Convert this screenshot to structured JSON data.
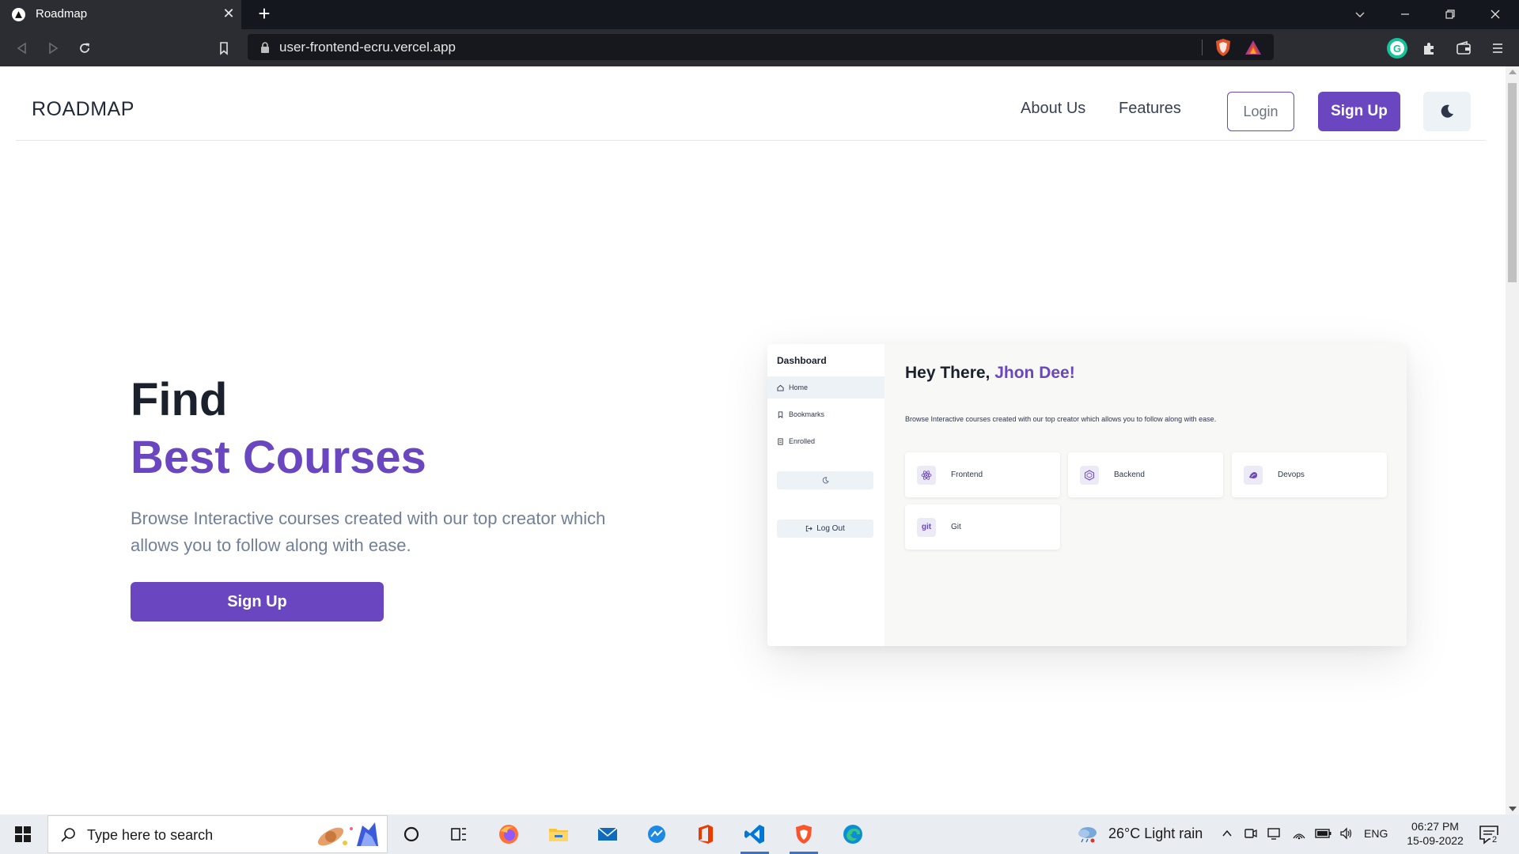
{
  "browser": {
    "tab_title": "Roadmap",
    "url": "user-frontend-ecru.vercel.app"
  },
  "site": {
    "logo": "ROADMAP",
    "nav": {
      "about": "About Us",
      "features": "Features",
      "login": "Login",
      "signup": "Sign Up"
    },
    "hero": {
      "line1": "Find",
      "line2": "Best Courses",
      "description": "Browse Interactive courses created with our top creator which allows you to follow along with ease.",
      "cta": "Sign Up"
    },
    "preview": {
      "sidebar_title": "Dashboard",
      "menu": [
        {
          "label": "Home",
          "icon": "home-icon",
          "active": true
        },
        {
          "label": "Bookmarks",
          "icon": "bookmark-icon",
          "active": false
        },
        {
          "label": "Enrolled",
          "icon": "enrolled-icon",
          "active": false
        }
      ],
      "logout": "Log Out",
      "greeting": "Hey There, ",
      "user_name": "Jhon Dee!",
      "description": "Browse Interactive courses created with our top creator which allows you to follow along with ease.",
      "courses": [
        {
          "label": "Frontend",
          "icon": "react-icon"
        },
        {
          "label": "Backend",
          "icon": "nodejs-icon"
        },
        {
          "label": "Devops",
          "icon": "devops-icon"
        },
        {
          "label": "Git",
          "icon": "git-icon",
          "icon_text": "git"
        }
      ]
    }
  },
  "taskbar": {
    "search_placeholder": "Type here to search",
    "weather": "26°C  Light rain",
    "language": "ENG",
    "time": "06:27 PM",
    "date": "15-09-2022",
    "notification_count": "2"
  },
  "colors": {
    "accent": "#6b46c1",
    "heading": "#1a202c",
    "body_text": "#718096"
  }
}
